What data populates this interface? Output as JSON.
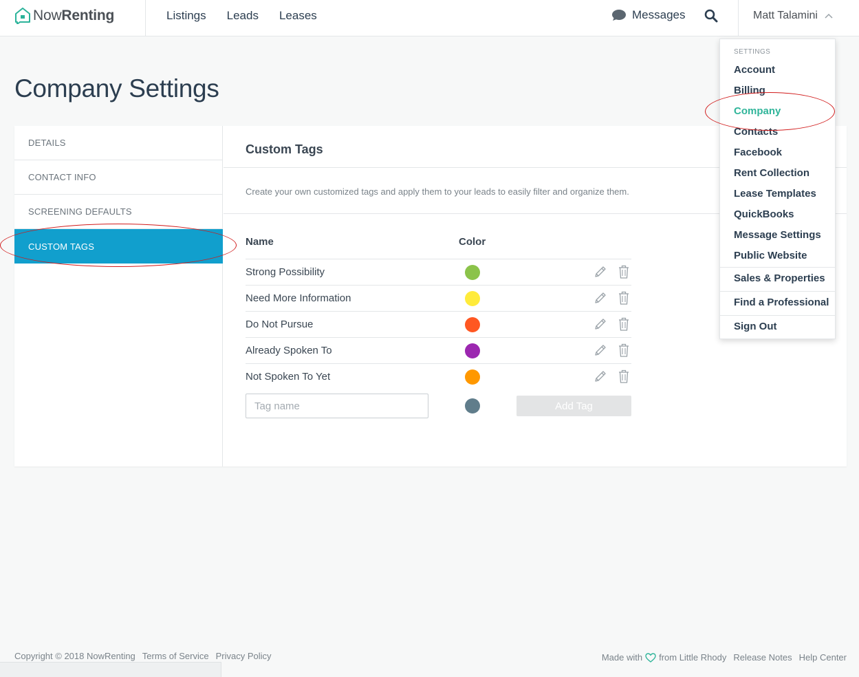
{
  "header": {
    "logo_light": "Now",
    "logo_bold": "Renting",
    "nav": [
      "Listings",
      "Leads",
      "Leases"
    ],
    "messages_label": "Messages",
    "user_name": "Matt Talamini"
  },
  "page": {
    "title": "Company Settings"
  },
  "sidebar": {
    "items": [
      {
        "label": "DETAILS"
      },
      {
        "label": "CONTACT INFO"
      },
      {
        "label": "SCREENING DEFAULTS"
      },
      {
        "label": "CUSTOM TAGS",
        "active": true
      }
    ]
  },
  "panel": {
    "title": "Custom Tags",
    "description": "Create your own customized tags and apply them to your leads to easily filter and organize them.",
    "col_name": "Name",
    "col_color": "Color",
    "tags": [
      {
        "name": "Strong Possibility",
        "color": "#8bc34a"
      },
      {
        "name": "Need More Information",
        "color": "#ffeb3b"
      },
      {
        "name": "Do Not Pursue",
        "color": "#ff5722"
      },
      {
        "name": "Already Spoken To",
        "color": "#9c27b0"
      },
      {
        "name": "Not Spoken To Yet",
        "color": "#ff9800"
      }
    ],
    "new_tag": {
      "placeholder": "Tag name",
      "color": "#607d8b",
      "button": "Add Tag"
    }
  },
  "dropdown": {
    "heading": "SETTINGS",
    "items": [
      "Account",
      "Billing",
      "Company",
      "Contacts",
      "Facebook",
      "Rent Collection",
      "Lease Templates",
      "QuickBooks",
      "Message Settings",
      "Public Website"
    ],
    "active": "Company",
    "sections": [
      "Sales & Properties",
      "Find a Professional",
      "Sign Out"
    ]
  },
  "footer": {
    "copyright": "Copyright © 2018 NowRenting",
    "terms": "Terms of Service",
    "privacy": "Privacy Policy",
    "made_with": "Made with",
    "from": "from Little Rhody",
    "release_notes": "Release Notes",
    "help_center": "Help Center"
  },
  "colors": {
    "accent_blue": "#119fcd",
    "accent_green": "#30b59a",
    "annotation_red": "#d11a1a"
  }
}
